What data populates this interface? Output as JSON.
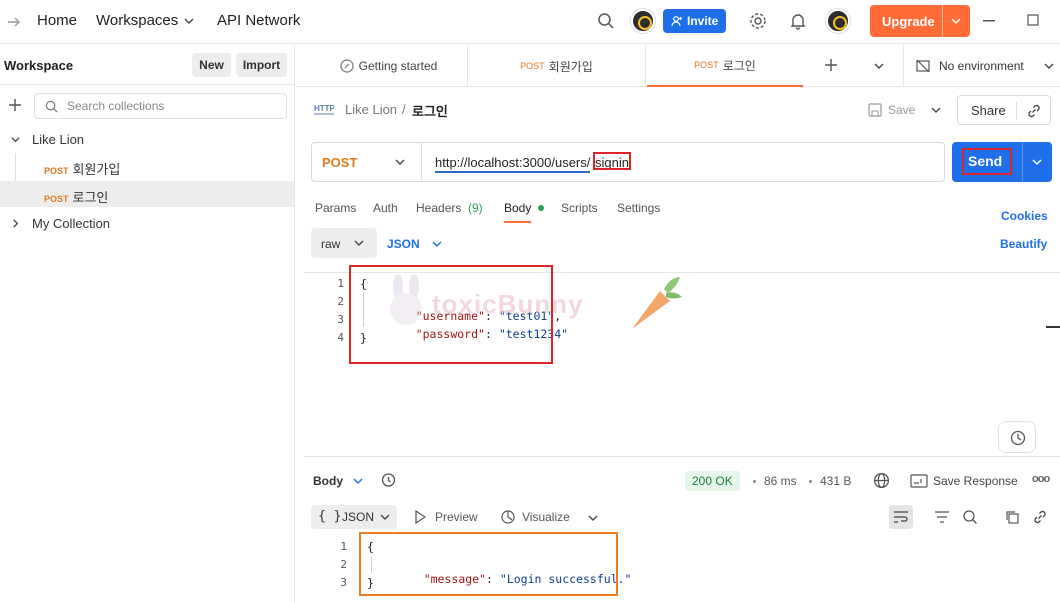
{
  "topbar": {
    "home": "Home",
    "workspaces": "Workspaces",
    "api_network": "API Network",
    "invite": "Invite",
    "upgrade": "Upgrade"
  },
  "sidebar": {
    "title": "Workspace",
    "new_btn": "New",
    "import_btn": "Import",
    "search_placeholder": "Search collections",
    "collections": [
      {
        "name": "Like Lion"
      },
      {
        "name": "My Collection"
      }
    ],
    "requests": [
      {
        "method": "POST",
        "name": "회원가입"
      },
      {
        "method": "POST",
        "name": "로그인"
      }
    ]
  },
  "tabs": [
    {
      "label": "Getting started"
    },
    {
      "method": "POST",
      "label": "회원가입"
    },
    {
      "method": "POST",
      "label": "로그인"
    }
  ],
  "environment": "No environment",
  "breadcrumb": {
    "collection": "Like Lion",
    "separator": "/",
    "request": "로그인"
  },
  "actions": {
    "save": "Save",
    "share": "Share"
  },
  "request": {
    "method": "POST",
    "url_base": "http://localhost:3000/users/",
    "url_path": "signin",
    "send": "Send"
  },
  "req_tabs": {
    "params": "Params",
    "auth": "Auth",
    "headers": "Headers",
    "headers_count": "(9)",
    "body": "Body",
    "scripts": "Scripts",
    "settings": "Settings",
    "cookies": "Cookies",
    "beautify": "Beautify"
  },
  "body_mode": {
    "raw": "raw",
    "format": "JSON"
  },
  "request_body": {
    "line_numbers": [
      "1",
      "2",
      "3",
      "4"
    ],
    "open_brace": "{",
    "close_brace": "}",
    "k1": "\"username\"",
    "v1": "\"test01\"",
    "k2": "\"password\"",
    "v2": "\"test1234\"",
    "colon": ":",
    "comma": ","
  },
  "watermark": "toxicBunny",
  "response": {
    "body_label": "Body",
    "status": "200 OK",
    "time": "86 ms",
    "size": "431 B",
    "save_response": "Save Response",
    "more": "ooo",
    "format": "JSON",
    "format_icon": "{ }",
    "preview": "Preview",
    "visualize": "Visualize",
    "line_numbers": [
      "1",
      "2",
      "3"
    ],
    "open_brace": "{",
    "close_brace": "}",
    "key": "\"message\"",
    "colon": ":",
    "value": "\"Login successful.\""
  }
}
